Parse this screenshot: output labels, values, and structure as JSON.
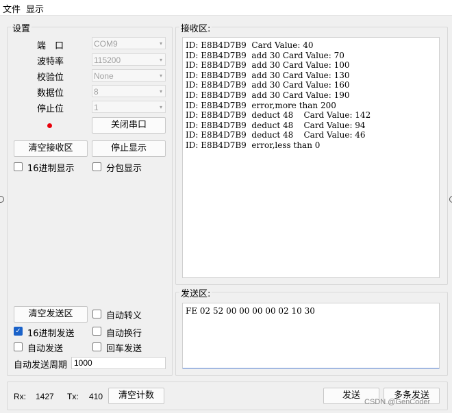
{
  "menu": {
    "file": "文件",
    "view": "显示"
  },
  "settings": {
    "title": "设置",
    "port_label": "端　口",
    "port_value": "COM9",
    "baud_label": "波特率",
    "baud_value": "115200",
    "parity_label": "校验位",
    "parity_value": "None",
    "databits_label": "数据位",
    "databits_value": "8",
    "stopbits_label": "停止位",
    "stopbits_value": "1",
    "status_color": "#e8000b",
    "close_port": "关闭串口",
    "clear_receive": "清空接收区",
    "stop_display": "停止显示",
    "hex_display": "16进制显示",
    "packet_display": "分包显示",
    "clear_send": "清空发送区",
    "auto_escape": "自动转义",
    "hex_send": "16进制发送",
    "auto_newline": "自动换行",
    "auto_send": "自动发送",
    "cr_send": "回车发送",
    "auto_period_label": "自动发送周期",
    "auto_period_value": "1000"
  },
  "receive": {
    "title": "接收区:",
    "lines": [
      "ID: E8B4D7B9  Card Value: 40",
      "ID: E8B4D7B9  add 30 Card Value: 70",
      "ID: E8B4D7B9  add 30 Card Value: 100",
      "ID: E8B4D7B9  add 30 Card Value: 130",
      "ID: E8B4D7B9  add 30 Card Value: 160",
      "ID: E8B4D7B9  add 30 Card Value: 190",
      "ID: E8B4D7B9  error,more than 200",
      "ID: E8B4D7B9  deduct 48    Card Value: 142",
      "ID: E8B4D7B9  deduct 48    Card Value: 94",
      "ID: E8B4D7B9  deduct 48    Card Value: 46",
      "ID: E8B4D7B9  error,less than 0"
    ]
  },
  "send": {
    "title": "发送区:",
    "content": "FE 02 52 00 00 00 00 02 10 30"
  },
  "status": {
    "rx_label": "Rx:",
    "rx_value": "1427",
    "tx_label": "Tx:",
    "tx_value": "410",
    "clear_count": "清空计数",
    "send": "发送",
    "multi_send": "多条发送"
  },
  "watermark": "CSDN @GenCoder"
}
